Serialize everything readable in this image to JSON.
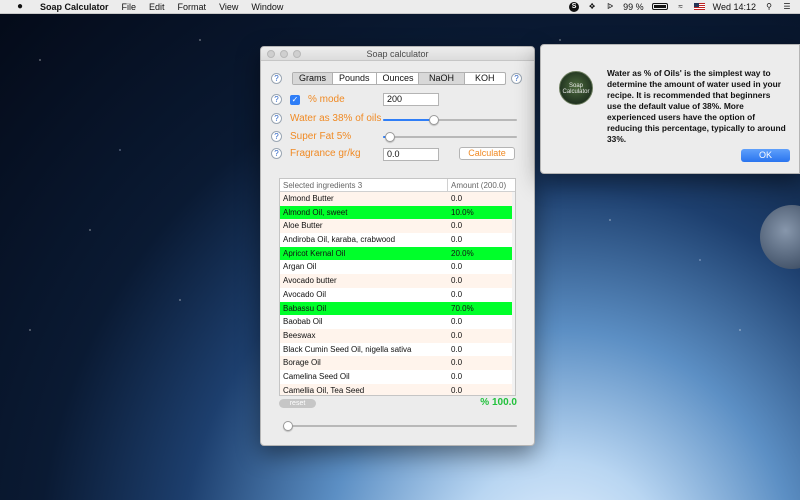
{
  "menubar": {
    "app_name": "Soap Calculator",
    "menus": [
      "File",
      "Edit",
      "Format",
      "View",
      "Window"
    ],
    "battery": "99 %",
    "clock": "Wed 14:12",
    "icons": [
      "apple-icon",
      "skype-icon",
      "dropbox-icon",
      "bluetooth-icon",
      "battery-icon",
      "wifi-icon",
      "flag-icon",
      "search-icon",
      "list-icon"
    ]
  },
  "window": {
    "title": "Soap calculator",
    "unit_options": [
      "Grams",
      "Pounds",
      "Ounces"
    ],
    "selected_unit": "Grams",
    "lye_options": [
      "NaOH",
      "KOH"
    ],
    "selected_lye": "NaOH",
    "percent_mode_label": "% mode",
    "percent_mode_checked": true,
    "oil_amount": "200",
    "water_label": "Water as 38% of oils",
    "water_slider": 0.38,
    "superfat_label": "Super Fat 5%",
    "superfat_slider": 0.05,
    "fragrance_label": "Fragrance gr/kg",
    "fragrance_value": "0.0",
    "calculate_label": "Calculate",
    "reset_label": "reset",
    "total_percent": "% 100.0",
    "bottom_slider": 0.0
  },
  "table": {
    "headers": [
      "Selected ingredients 3",
      "Amount (200.0)"
    ],
    "rows": [
      {
        "name": "Almond Butter",
        "amount": "0.0",
        "selected": false
      },
      {
        "name": "Almond Oil, sweet",
        "amount": "10.0%",
        "selected": true
      },
      {
        "name": "Aloe Butter",
        "amount": "0.0",
        "selected": false
      },
      {
        "name": "Andiroba Oil, karaba, crabwood",
        "amount": "0.0",
        "selected": false
      },
      {
        "name": "Apricot Kernal Oil",
        "amount": "20.0%",
        "selected": true
      },
      {
        "name": "Argan Oil",
        "amount": "0.0",
        "selected": false
      },
      {
        "name": "Avocado butter",
        "amount": "0.0",
        "selected": false
      },
      {
        "name": "Avocado Oil",
        "amount": "0.0",
        "selected": false
      },
      {
        "name": "Babassu Oil",
        "amount": "70.0%",
        "selected": true
      },
      {
        "name": "Baobab Oil",
        "amount": "0.0",
        "selected": false
      },
      {
        "name": "Beeswax",
        "amount": "0.0",
        "selected": false
      },
      {
        "name": "Black Cumin Seed Oil, nigella sativa",
        "amount": "0.0",
        "selected": false
      },
      {
        "name": "Borage Oil",
        "amount": "0.0",
        "selected": false
      },
      {
        "name": "Camelina Seed Oil",
        "amount": "0.0",
        "selected": false
      },
      {
        "name": "Camellia Oil, Tea Seed",
        "amount": "0.0",
        "selected": false
      }
    ]
  },
  "popup": {
    "logo_text": "Soap Calculator",
    "message": "Water as % of Oils' is the simplest way to determine the amount of water used in your recipe. It is recommended that beginners use the default value of 38%.  More experienced users have the option of reducing this percentage, typically to around 33%.",
    "ok_label": "OK"
  },
  "colors": {
    "accent_orange": "#f08a24",
    "selection_green": "#00ff2a",
    "total_green": "#22c13c",
    "control_blue": "#2f7ef7"
  }
}
